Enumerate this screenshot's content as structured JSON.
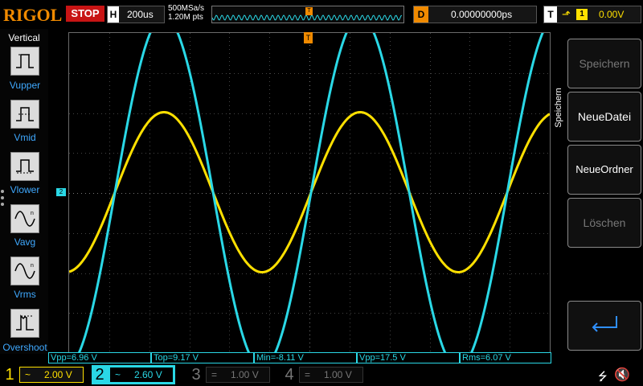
{
  "top": {
    "brand": "RIGOL",
    "run_state": "STOP",
    "horizontal": {
      "label": "H",
      "timebase": "200us"
    },
    "sample_rate": "500MSa/s",
    "memory_depth": "1.20M pts",
    "delay": {
      "label": "D",
      "value": "0.00000000ps"
    },
    "trigger": {
      "label": "T",
      "edge": "⬏",
      "source": "1",
      "level": "0.00V"
    }
  },
  "left_panel": {
    "title": "Vertical",
    "items": [
      {
        "label": "Vupper",
        "icon": "vupper-icon"
      },
      {
        "label": "Vmid",
        "icon": "vmid-icon"
      },
      {
        "label": "Vlower",
        "icon": "vlower-icon"
      },
      {
        "label": "Vavg",
        "icon": "vavg-icon"
      },
      {
        "label": "Vrms",
        "icon": "vrms-icon"
      },
      {
        "label": "Overshoot",
        "icon": "overshoot-icon"
      }
    ]
  },
  "markers": {
    "ch2": "2",
    "trigger_level": "T",
    "trigger_position": "T"
  },
  "right_panel": {
    "title": "Speichern",
    "buttons": [
      {
        "label": "Speichern",
        "enabled": false
      },
      {
        "label": "NeueDatei",
        "enabled": true
      },
      {
        "label": "NeueOrdner",
        "enabled": true
      },
      {
        "label": "Löschen",
        "enabled": false
      }
    ],
    "return_icon": "return-arrow-icon"
  },
  "measurements": [
    {
      "text": "Vpp=6.96 V"
    },
    {
      "text": "Top=9.17 V"
    },
    {
      "text": "Min=-8.11 V"
    },
    {
      "text": "Vpp=17.5 V"
    },
    {
      "text": "Rms=6.07 V"
    }
  ],
  "channels": [
    {
      "num": "1",
      "coupling": "~",
      "scale": "2.00 V"
    },
    {
      "num": "2",
      "coupling": "~",
      "scale": "2.60 V"
    },
    {
      "num": "3",
      "coupling": "=",
      "scale": "1.00 V"
    },
    {
      "num": "4",
      "coupling": "=",
      "scale": "1.00 V"
    }
  ],
  "colors": {
    "ch1": "#ffe000",
    "ch2": "#2ad8e6",
    "brand": "#f08a00",
    "stop": "#c81414"
  },
  "chart_data": {
    "type": "line",
    "xlabel": "",
    "ylabel": "",
    "timebase_per_div": "200us",
    "series": [
      {
        "trace": "ch1",
        "amplitude_div": 2.0,
        "cycles": 2.45
      },
      {
        "trace": "ch2",
        "amplitude_div": 4.4,
        "cycles": 2.45
      }
    ]
  },
  "status_icons": {
    "usb": "usb-icon",
    "mute": "speaker-mute-icon"
  }
}
